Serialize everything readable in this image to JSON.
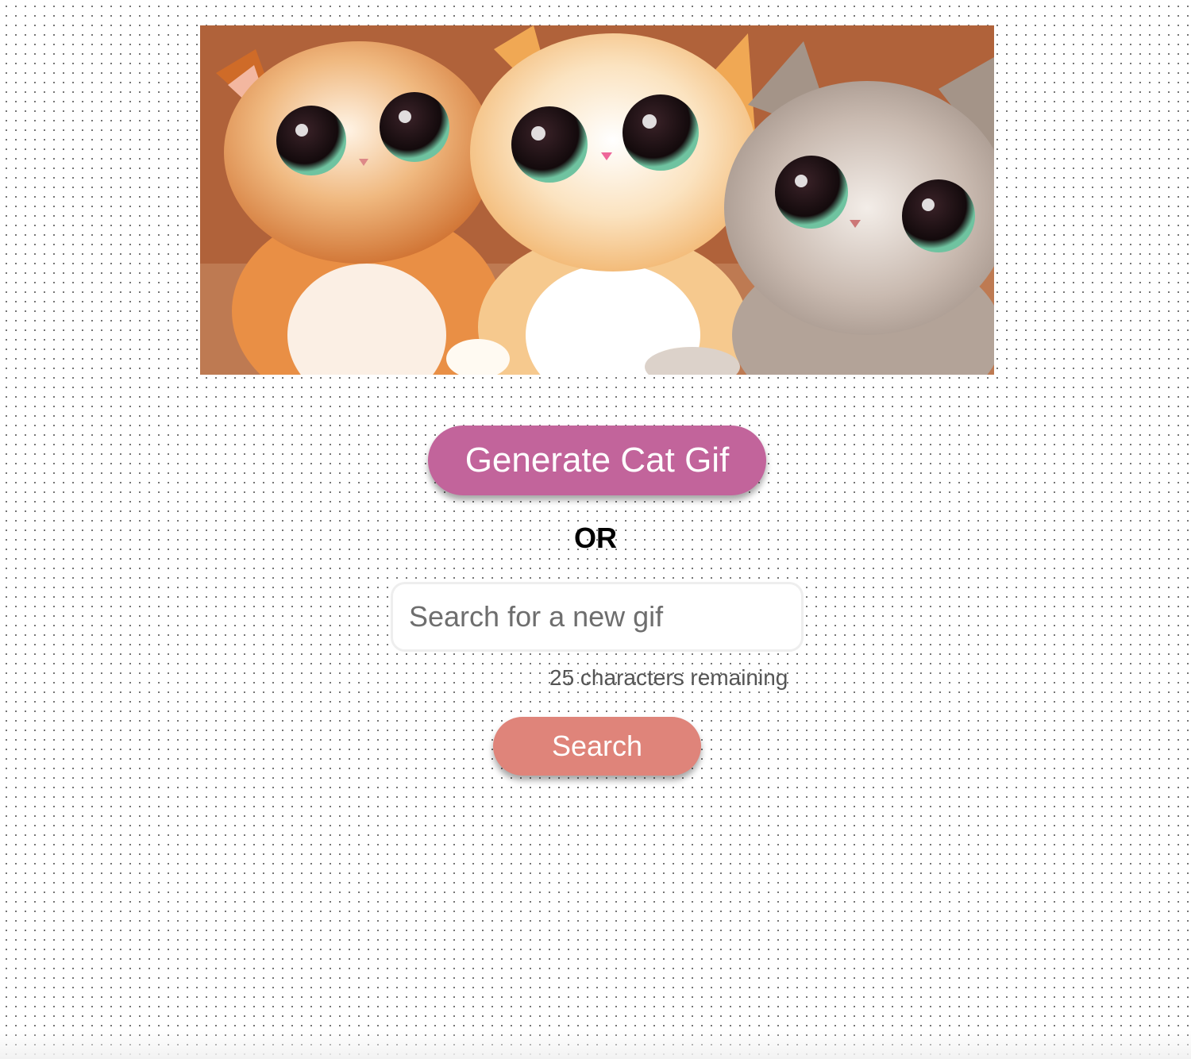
{
  "gif": {
    "image_alt": "three big-eyed cartoon kittens",
    "colors": {
      "kitten_left": "#d8742e",
      "kitten_middle": "#f1b466",
      "kitten_right": "#a49488",
      "eye": "#1a0f12",
      "iris": "#7fd0a8"
    }
  },
  "generate_button": {
    "label": "Generate Cat Gif",
    "color": "#c2649b"
  },
  "separator": {
    "label": "OR"
  },
  "search": {
    "placeholder": "Search for a new gif",
    "value": "",
    "counter_text": "25 characters remaining"
  },
  "search_button": {
    "label": "Search",
    "color": "#df847a"
  }
}
